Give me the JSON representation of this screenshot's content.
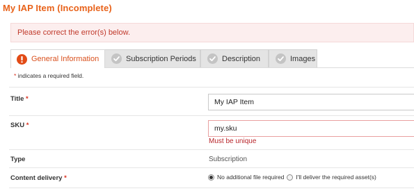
{
  "page_title": "My IAP Item (Incomplete)",
  "error_banner": "Please correct the error(s) below.",
  "tabs": [
    {
      "label": "General Information",
      "icon": "error-icon",
      "active": true
    },
    {
      "label": "Subscription Periods",
      "icon": "check-circle-icon",
      "active": false
    },
    {
      "label": "Description",
      "icon": "check-circle-icon",
      "active": false
    },
    {
      "label": "Images",
      "icon": "check-circle-icon",
      "active": false
    }
  ],
  "required_note": {
    "star": "*",
    "text": " indicates a required field."
  },
  "fields": {
    "title": {
      "label": "Title",
      "star": "*",
      "value": "My IAP Item"
    },
    "sku": {
      "label": "SKU",
      "star": "*",
      "value": "my.sku",
      "error": "Must be unique"
    },
    "type": {
      "label": "Type",
      "value": "Subscription"
    },
    "content_delivery": {
      "label": "Content delivery",
      "star": "*",
      "options": [
        {
          "label": "No additional file required",
          "selected": true
        },
        {
          "label": "I'll deliver the required asset(s)",
          "selected": false
        }
      ]
    }
  },
  "colors": {
    "accent": "#e8621a",
    "error": "#c0392b",
    "error_bg": "#fceeee"
  }
}
